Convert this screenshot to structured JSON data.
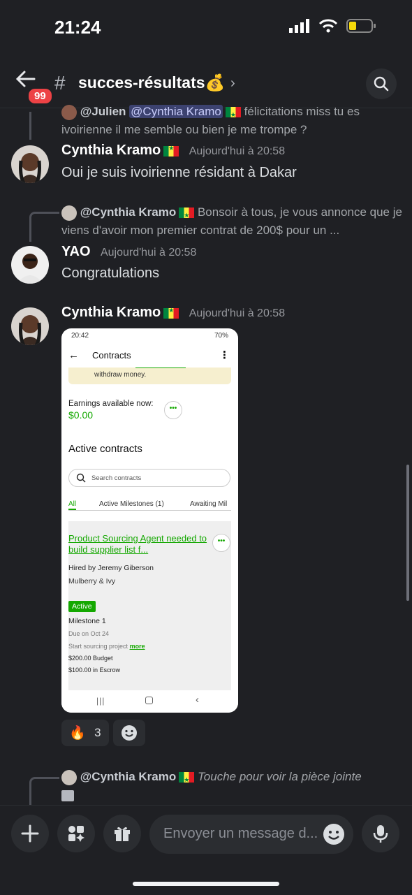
{
  "status": {
    "time": "21:24"
  },
  "header": {
    "badge": "99",
    "hash": "#",
    "channel": "succes-résultats💰",
    "chevron": "›"
  },
  "messages": {
    "reply1": {
      "user": "@Julien",
      "mention": "@Cynthia Kramo",
      "text": "félicitations miss tu es ivoirienne il me semble ou bien je me trompe ?"
    },
    "m1": {
      "author": "Cynthia Kramo",
      "time": "Aujourd'hui à 20:58",
      "text": "Oui je suis ivoirienne résidant à Dakar"
    },
    "reply2": {
      "user": "@Cynthia Kramo",
      "text": "Bonsoir à tous, je vous annonce que je viens d'avoir mon premier contrat de 200$ pour un ..."
    },
    "m2": {
      "author": "YAO",
      "time": "Aujourd'hui à 20:58",
      "text": "Congratulations"
    },
    "m3": {
      "author": "Cynthia Kramo",
      "time": "Aujourd'hui à 20:58"
    },
    "reply3": {
      "user": "@Cynthia Kramo",
      "text": "Touche pour voir la pièce jointe"
    }
  },
  "attachment": {
    "status_time": "20:42",
    "battery": "70%",
    "title": "Contracts",
    "banner": "withdraw money.",
    "earnings_label": "Earnings available now:",
    "earnings_value": "$0.00",
    "section": "Active contracts",
    "search_placeholder": "Search contracts",
    "tabs": [
      "All",
      "Active Milestones (1)",
      "Awaiting Mil"
    ],
    "card": {
      "title": "Product Sourcing Agent needed to build supplier list f...",
      "hired_by": "Hired by Jeremy Giberson",
      "company": "Mulberry & Ivy",
      "status": "Active",
      "milestone": "Milestone 1",
      "due": "Due on Oct 24",
      "desc": "Start sourcing project",
      "more": "more",
      "budget": "$200.00 Budget",
      "escrow": "$100.00 in Escrow"
    }
  },
  "reactions": {
    "fire_emoji": "🔥",
    "fire_count": "3"
  },
  "composer": {
    "placeholder": "Envoyer un message d..."
  },
  "colors": {
    "bg": "#1f2024",
    "accent_green": "#14a800",
    "badge_red": "#ed4245"
  }
}
